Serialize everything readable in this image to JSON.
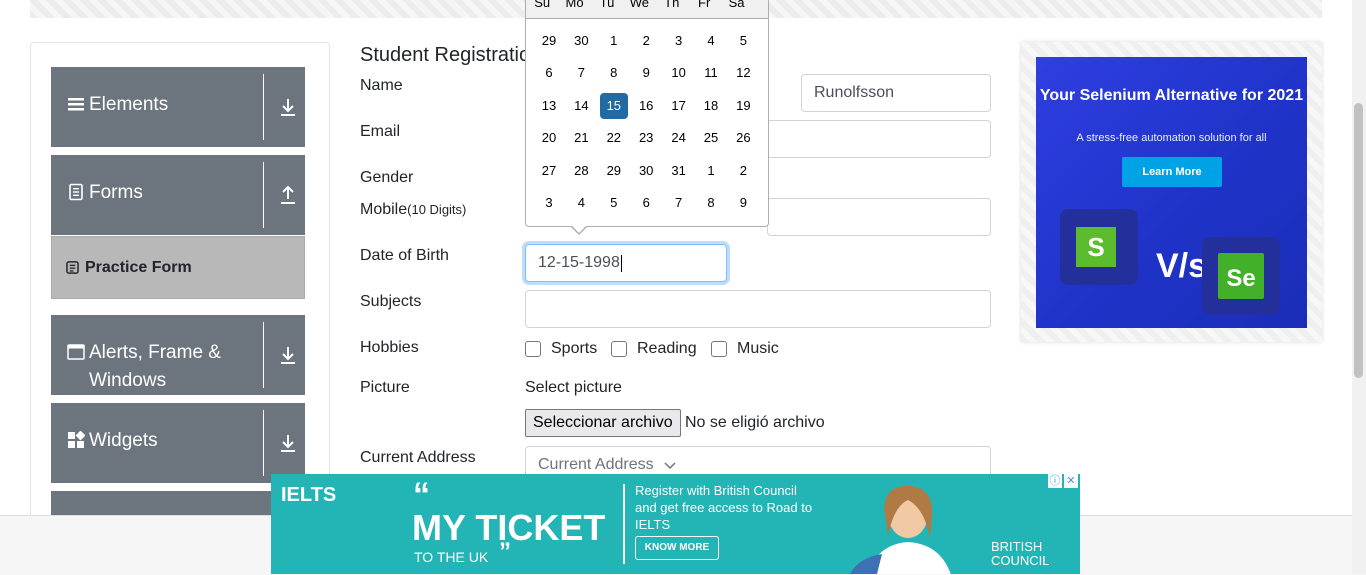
{
  "sidebar": {
    "groups": [
      {
        "label": "Elements"
      },
      {
        "label": "Forms"
      },
      {
        "label": "Alerts, Frame & Windows"
      },
      {
        "label": "Widgets"
      }
    ],
    "active_item": "Practice Form"
  },
  "form": {
    "title": "Student Registratio",
    "labels": {
      "name": "Name",
      "email": "Email",
      "gender": "Gender",
      "mobile": "Mobile",
      "mobile_hint": "(10 Digits)",
      "dob": "Date of Birth",
      "subjects": "Subjects",
      "hobbies": "Hobbies",
      "picture": "Picture",
      "address": "Current Address"
    },
    "last_name_value": "Runolfsson",
    "dob_value": "12-15-1998",
    "hobbies": [
      "Sports",
      "Reading",
      "Music"
    ],
    "select_picture": "Select picture",
    "file_button": "Seleccionar archivo",
    "file_status": "No se eligió archivo",
    "address_placeholder": "Current Address"
  },
  "calendar": {
    "weekdays": [
      "Su",
      "Mo",
      "Tu",
      "We",
      "Th",
      "Fr",
      "Sa"
    ],
    "weeks": [
      [
        "29",
        "30",
        "1",
        "2",
        "3",
        "4",
        "5"
      ],
      [
        "6",
        "7",
        "8",
        "9",
        "10",
        "11",
        "12"
      ],
      [
        "13",
        "14",
        "15",
        "16",
        "17",
        "18",
        "19"
      ],
      [
        "20",
        "21",
        "22",
        "23",
        "24",
        "25",
        "26"
      ],
      [
        "27",
        "28",
        "29",
        "30",
        "31",
        "1",
        "2"
      ],
      [
        "3",
        "4",
        "5",
        "6",
        "7",
        "8",
        "9"
      ]
    ],
    "selected": "15"
  },
  "ad_right": {
    "headline": "Your Selenium Alternative for 2021",
    "subline": "A stress-free automation solution for all",
    "button": "Learn More",
    "vs": "V/s"
  },
  "ad_bottom": {
    "brand": "IELTS",
    "open_quote": "“",
    "ticket": "MY TICKET",
    "to_uk": "TO THE UK",
    "close_quote": "”",
    "register": "Register with British Council and get free access to Road to IELTS",
    "know_more": "KNOW MORE",
    "council": "BRITISH COUNCIL"
  },
  "colors": {
    "sidebar_group": "#6c757d",
    "calendar_selected": "#216ba5",
    "ad_teal": "#23b5b6",
    "ad_blue": "#1f33c9"
  }
}
